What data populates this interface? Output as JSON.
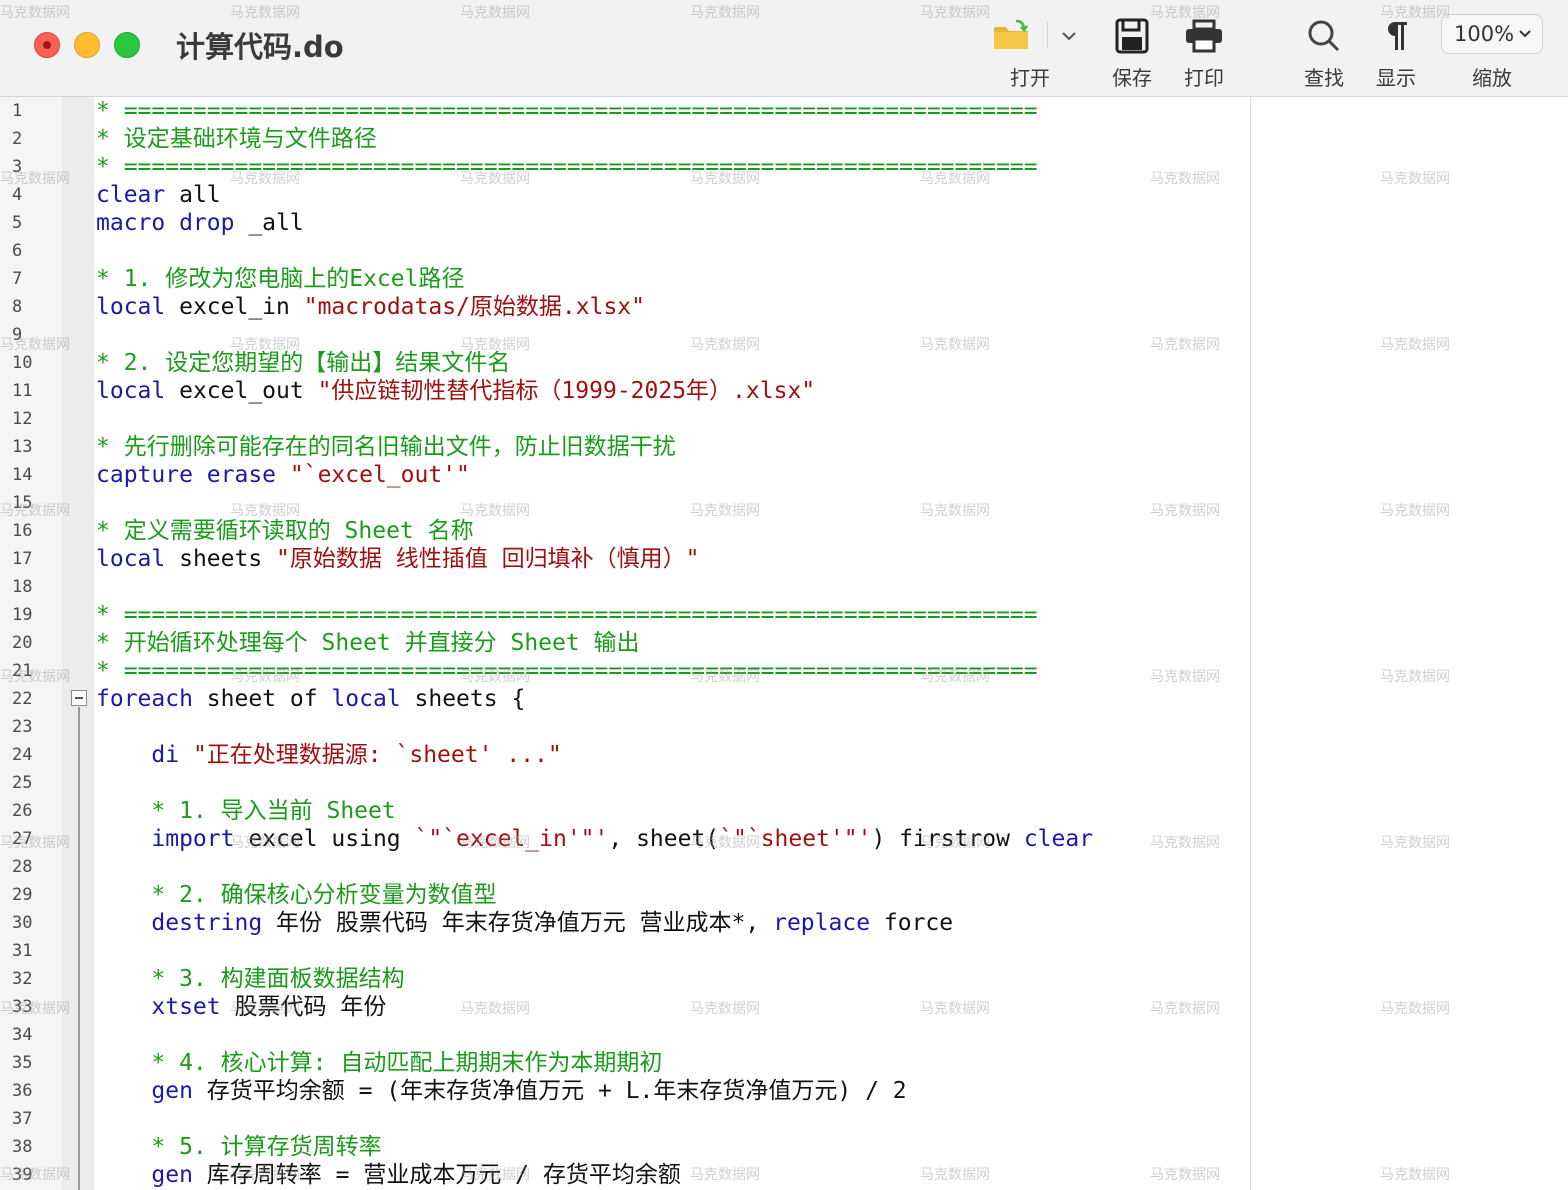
{
  "window": {
    "title": "计算代码.do"
  },
  "toolbar": {
    "open_label": "打开",
    "save_label": "保存",
    "print_label": "打印",
    "find_label": "查找",
    "show_label": "显示",
    "zoom_label": "缩放",
    "zoom_value": "100%"
  },
  "watermark": "马克数据网",
  "editor": {
    "line_numbers": [
      "1",
      "2",
      "3",
      "4",
      "5",
      "6",
      "7",
      "8",
      "9",
      "10",
      "11",
      "12",
      "13",
      "14",
      "15",
      "16",
      "17",
      "18",
      "19",
      "20",
      "21",
      "22",
      "23",
      "24",
      "25",
      "26",
      "27",
      "28",
      "29",
      "30",
      "31",
      "32",
      "33",
      "34",
      "35",
      "36",
      "37",
      "38",
      "39"
    ],
    "lines": [
      [
        {
          "t": "* ==================================================================",
          "c": "c"
        }
      ],
      [
        {
          "t": "* 设定基础环境与文件路径",
          "c": "c"
        }
      ],
      [
        {
          "t": "* ==================================================================",
          "c": "c"
        }
      ],
      [
        {
          "t": "clear",
          "c": "k"
        },
        {
          "t": " all",
          "c": "p"
        }
      ],
      [
        {
          "t": "macro drop",
          "c": "k"
        },
        {
          "t": " _all",
          "c": "p"
        }
      ],
      [],
      [
        {
          "t": "* 1. 修改为您电脑上的Excel路径",
          "c": "c"
        }
      ],
      [
        {
          "t": "local",
          "c": "k"
        },
        {
          "t": " excel_in ",
          "c": "p"
        },
        {
          "t": "\"macrodatas/原始数据.xlsx\"",
          "c": "s"
        }
      ],
      [],
      [
        {
          "t": "* 2. 设定您期望的【输出】结果文件名",
          "c": "c"
        }
      ],
      [
        {
          "t": "local",
          "c": "k"
        },
        {
          "t": " excel_out ",
          "c": "p"
        },
        {
          "t": "\"供应链韧性替代指标（1999-2025年）.xlsx\"",
          "c": "s"
        }
      ],
      [],
      [
        {
          "t": "* 先行删除可能存在的同名旧输出文件，防止旧数据干扰",
          "c": "c"
        }
      ],
      [
        {
          "t": "capture erase",
          "c": "k"
        },
        {
          "t": " ",
          "c": "p"
        },
        {
          "t": "\"`excel_out'\"",
          "c": "s"
        }
      ],
      [],
      [
        {
          "t": "* 定义需要循环读取的 Sheet 名称",
          "c": "c"
        }
      ],
      [
        {
          "t": "local",
          "c": "k"
        },
        {
          "t": " sheets ",
          "c": "p"
        },
        {
          "t": "\"原始数据 线性插值 回归填补（慎用）\"",
          "c": "s"
        }
      ],
      [],
      [
        {
          "t": "* ==================================================================",
          "c": "c"
        }
      ],
      [
        {
          "t": "* 开始循环处理每个 Sheet 并直接分 Sheet 输出",
          "c": "c"
        }
      ],
      [
        {
          "t": "* ==================================================================",
          "c": "c"
        }
      ],
      [
        {
          "t": "foreach",
          "c": "k"
        },
        {
          "t": " sheet of ",
          "c": "p"
        },
        {
          "t": "local",
          "c": "k"
        },
        {
          "t": " sheets {",
          "c": "p"
        }
      ],
      [],
      [
        {
          "t": "    ",
          "c": "p"
        },
        {
          "t": "di",
          "c": "k"
        },
        {
          "t": " ",
          "c": "p"
        },
        {
          "t": "\"正在处理数据源: `sheet' ...\"",
          "c": "s"
        }
      ],
      [],
      [
        {
          "t": "    * 1. 导入当前 Sheet",
          "c": "c"
        }
      ],
      [
        {
          "t": "    ",
          "c": "p"
        },
        {
          "t": "import",
          "c": "k"
        },
        {
          "t": " excel using ",
          "c": "p"
        },
        {
          "t": "`\"`excel_in'\"'",
          "c": "s"
        },
        {
          "t": ", sheet(",
          "c": "p"
        },
        {
          "t": "`\"`sheet'\"'",
          "c": "s"
        },
        {
          "t": ") firstrow ",
          "c": "p"
        },
        {
          "t": "clear",
          "c": "k"
        }
      ],
      [],
      [
        {
          "t": "    * 2. 确保核心分析变量为数值型",
          "c": "c"
        }
      ],
      [
        {
          "t": "    ",
          "c": "p"
        },
        {
          "t": "destring",
          "c": "k"
        },
        {
          "t": " 年份 股票代码 年末存货净值万元 营业成本*, ",
          "c": "p"
        },
        {
          "t": "replace",
          "c": "k"
        },
        {
          "t": " force",
          "c": "p"
        }
      ],
      [],
      [
        {
          "t": "    * 3. 构建面板数据结构",
          "c": "c"
        }
      ],
      [
        {
          "t": "    ",
          "c": "p"
        },
        {
          "t": "xtset",
          "c": "k"
        },
        {
          "t": " 股票代码 年份",
          "c": "p"
        }
      ],
      [],
      [
        {
          "t": "    * 4. 核心计算: 自动匹配上期期末作为本期期初",
          "c": "c"
        }
      ],
      [
        {
          "t": "    ",
          "c": "p"
        },
        {
          "t": "gen",
          "c": "k"
        },
        {
          "t": " 存货平均余额 = (年末存货净值万元 + L.年末存货净值万元) / 2",
          "c": "p"
        }
      ],
      [],
      [
        {
          "t": "    * 5. 计算存货周转率",
          "c": "c"
        }
      ],
      [
        {
          "t": "    ",
          "c": "p"
        },
        {
          "t": "gen",
          "c": "k"
        },
        {
          "t": " 库存周转率 = 营业成本万元 / 存货平均余额",
          "c": "p"
        }
      ]
    ]
  },
  "colors": {
    "comment": "#1a9c1a",
    "keyword": "#1a1aa6",
    "string": "#a01010",
    "text": "#111111"
  }
}
